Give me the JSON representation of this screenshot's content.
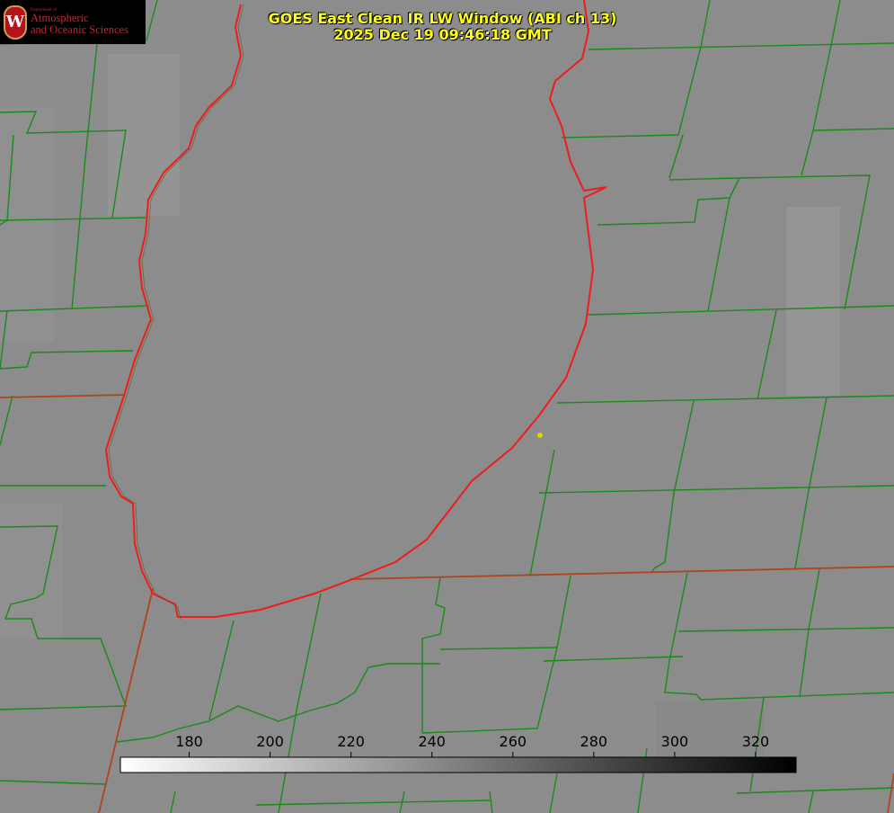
{
  "header": {
    "title_line1": "GOES East Clean IR LW Window (ABI ch 13)",
    "title_line2": "2025 Dec 19 09:46:18 GMT"
  },
  "logo": {
    "dept_text": "Department of",
    "line1": "Atmospheric",
    "line2": "and Oceanic Sciences",
    "crest_letter": "W"
  },
  "colorbar": {
    "min": 163,
    "max": 330,
    "ticks": [
      {
        "label": "180",
        "value": 180
      },
      {
        "label": "200",
        "value": 200
      },
      {
        "label": "220",
        "value": 220
      },
      {
        "label": "240",
        "value": 240
      },
      {
        "label": "260",
        "value": 260
      },
      {
        "label": "280",
        "value": 280
      },
      {
        "label": "300",
        "value": 300
      },
      {
        "label": "320",
        "value": 320
      }
    ],
    "colors": {
      "low": "#ffffff",
      "high": "#000000"
    }
  },
  "colors": {
    "background": "#8c8c8c",
    "county_lines": "#1a8a1a",
    "state_lines": "#b0431a",
    "lake_coast": "#ee1c1c",
    "title_text": "#ffff1a"
  }
}
